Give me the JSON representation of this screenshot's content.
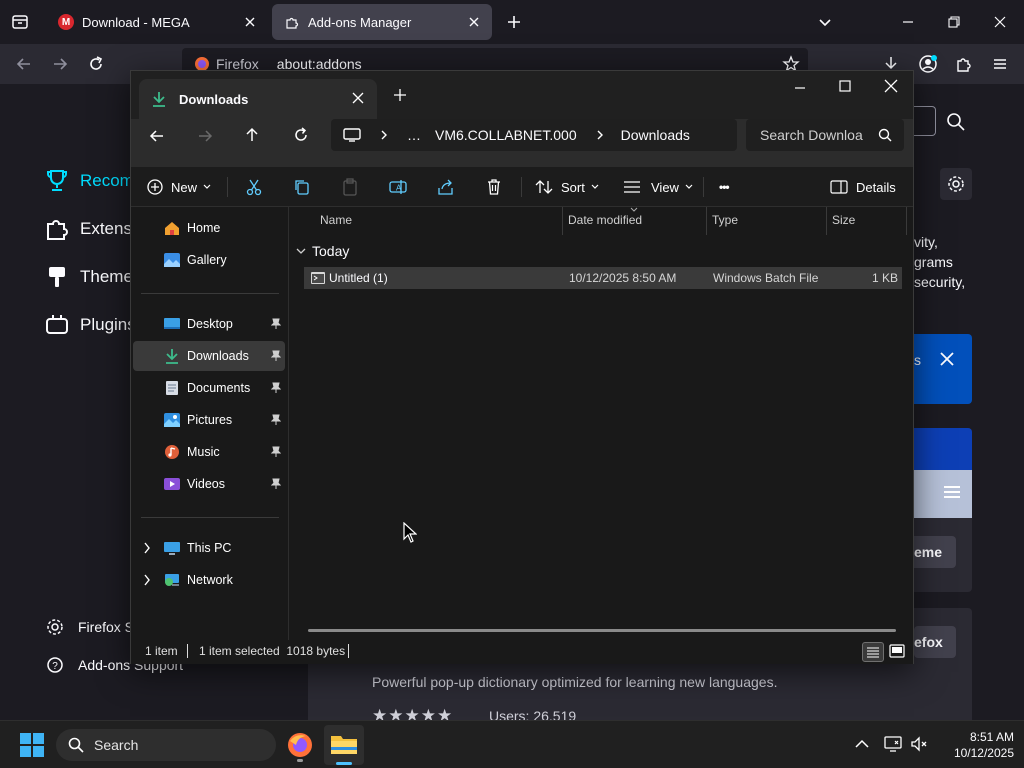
{
  "firefox": {
    "tabs": [
      {
        "title": "Download - MEGA",
        "favicon_letter": "M",
        "favicon_color": "#d9272e"
      },
      {
        "title": "Add-ons Manager"
      }
    ],
    "urlbar": {
      "identity": "Firefox",
      "url": "about:addons"
    }
  },
  "addons": {
    "categories": [
      "Recomm",
      "Extensio",
      "Themes",
      "Plugins"
    ],
    "footer": [
      "Firefox S",
      "Add-ons Support"
    ],
    "right_snippets": [
      "vity,",
      "grams",
      "security,"
    ],
    "button_fragments": [
      "eme",
      "efox"
    ],
    "card_desc": "Powerful pop-up dictionary optimized for learning new languages.",
    "card_users": "Users: 26,519",
    "accent_color": "#00ddff",
    "notice_bg": "#0250bb"
  },
  "explorer": {
    "tab_title": "Downloads",
    "breadcrumb": [
      "…",
      "VM6.COLLABNET.000",
      "Downloads"
    ],
    "search_placeholder": "Search Downloa",
    "commands": {
      "new": "New",
      "sort": "Sort",
      "view": "View",
      "more": "•••",
      "details": "Details"
    },
    "nav": {
      "quick": [
        {
          "label": "Home",
          "icon": "home-icon"
        },
        {
          "label": "Gallery",
          "icon": "gallery-icon"
        }
      ],
      "pinned": [
        {
          "label": "Desktop",
          "icon": "desktop-icon"
        },
        {
          "label": "Downloads",
          "icon": "downloads-icon",
          "selected": true
        },
        {
          "label": "Documents",
          "icon": "documents-icon"
        },
        {
          "label": "Pictures",
          "icon": "pictures-icon"
        },
        {
          "label": "Music",
          "icon": "music-icon"
        },
        {
          "label": "Videos",
          "icon": "videos-icon"
        }
      ],
      "drives": [
        {
          "label": "This PC",
          "icon": "this-pc-icon"
        },
        {
          "label": "Network",
          "icon": "network-icon"
        }
      ]
    },
    "columns": [
      "Name",
      "Date modified",
      "Type",
      "Size"
    ],
    "group": "Today",
    "files": [
      {
        "name": "Untitled (1)",
        "date": "10/12/2025 8:50 AM",
        "type": "Windows Batch File",
        "size": "1 KB"
      }
    ],
    "status": {
      "count": "1 item",
      "selected": "1 item selected  1018 bytes"
    },
    "selection_color": "#3a3a3a"
  },
  "taskbar": {
    "search_label": "Search",
    "time": "8:51 AM",
    "date": "10/12/2025"
  }
}
